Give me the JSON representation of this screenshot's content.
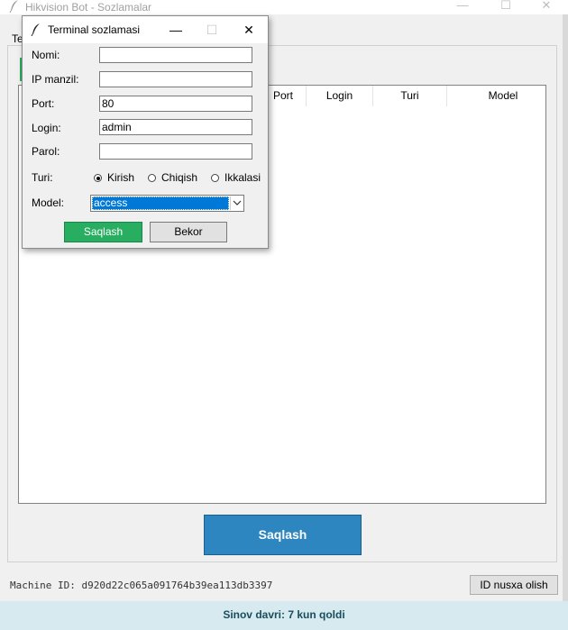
{
  "main_window": {
    "title": "Hikvision Bot - Sozlamalar",
    "minimize_glyph": "—",
    "maximize_glyph": "☐",
    "close_glyph": "✕",
    "tab_label": "Te",
    "table_columns": [
      "Port",
      "Login",
      "Turi",
      "Model"
    ],
    "save_label": "Saqlash",
    "machine_id": "Machine ID: d920d22c065a091764b39ea113db3397",
    "copy_id_label": "ID nusxa olish",
    "status_text": "Sinov davri: 7 kun qoldi"
  },
  "dialog": {
    "title": "Terminal sozlamasi",
    "minimize_glyph": "—",
    "maximize_glyph": "☐",
    "close_glyph": "✕",
    "fields": {
      "name_label": "Nomi:",
      "name_value": "",
      "ip_label": "IP manzil:",
      "ip_value": "",
      "port_label": "Port:",
      "port_value": "80",
      "login_label": "Login:",
      "login_value": "admin",
      "password_label": "Parol:",
      "password_value": ""
    },
    "type_label": "Turi:",
    "type_options": [
      "Kirish",
      "Chiqish",
      "Ikkalasi"
    ],
    "type_selected": "Kirish",
    "model_label": "Model:",
    "model_value": "access",
    "save_label": "Saqlash",
    "cancel_label": "Bekor"
  },
  "colors": {
    "accent_blue": "#2e86c1",
    "accent_green": "#27ae60",
    "status_bg": "#d6eaf0",
    "selection_blue": "#0078d7"
  },
  "icons": [
    "feather-icon",
    "minimize-icon",
    "maximize-icon",
    "close-icon",
    "chevron-down-icon"
  ]
}
